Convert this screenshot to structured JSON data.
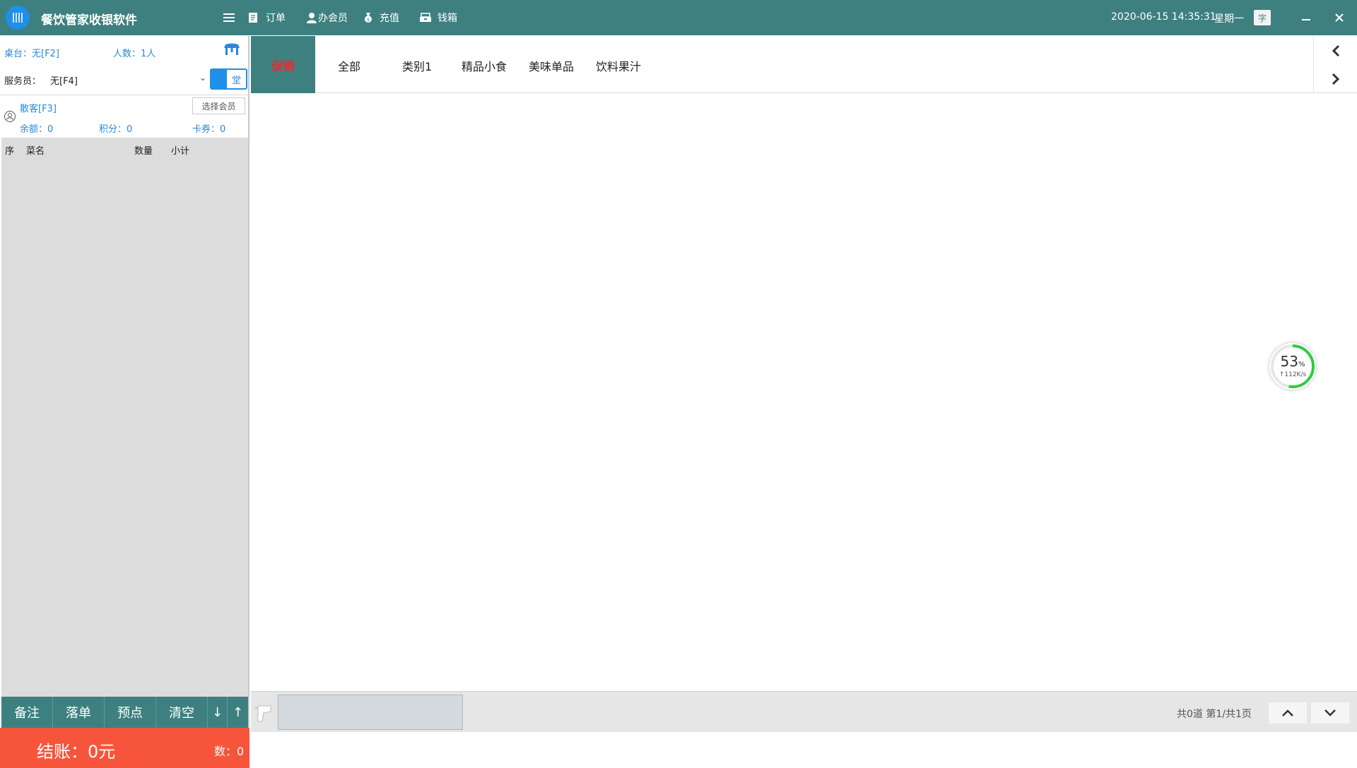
{
  "app": {
    "title": "餐饮管家收银软件"
  },
  "toolbar": {
    "menu": "",
    "orders": "订单",
    "member": "办会员",
    "recharge": "充值",
    "cashbox": "钱箱"
  },
  "status": {
    "datetime": "2020-06-15 14:35:31",
    "weekday": "星期一",
    "font_btn": "字"
  },
  "order_panel": {
    "table": "桌台：无[F2]",
    "people": "人数：1人",
    "waiter_label": "服务员：",
    "waiter_value": "无[F4]",
    "dine_mode": "堂",
    "member_name": "散客[F3]",
    "choose_member": "选择会员",
    "balance": "余额：0",
    "points": "积分：0",
    "coupons": "卡券：0",
    "columns": [
      "序",
      "菜名",
      "数量",
      "小计"
    ],
    "actions": [
      "备注",
      "落单",
      "预点",
      "清空",
      "↓",
      "↑"
    ],
    "checkout": "结账：0元",
    "count": "数：0"
  },
  "categories": [
    "促销",
    "全部",
    "类别1",
    "精品小食",
    "美味单品",
    "饮料果汁"
  ],
  "speed": {
    "percent": "53",
    "unit": "%",
    "rate": "↑112K/s"
  },
  "pager": {
    "info": "共0道  第1/共1页"
  },
  "colors": {
    "header": "#3e8080",
    "accent": "#1e90e8",
    "checkout": "#f7553b",
    "promo": "#f0282d"
  }
}
